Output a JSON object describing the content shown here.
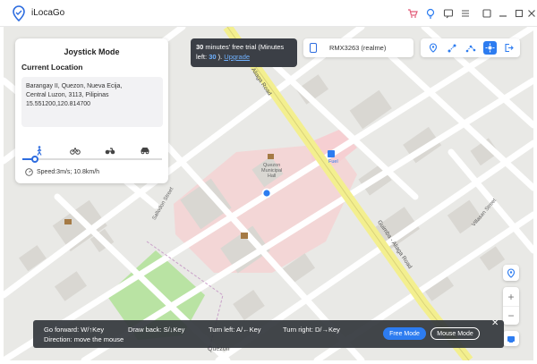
{
  "app": {
    "title": "iLocaGo"
  },
  "titlebar": {
    "icons": [
      "cart-icon",
      "bulb-icon",
      "message-icon",
      "menu-icon",
      "minimize-icon",
      "restore-icon",
      "close-icon"
    ]
  },
  "joystick": {
    "title": "Joystick Mode",
    "current_location_label": "Current Location",
    "address_lines": [
      "Barangay II, Quezon, Nueva Ecija,",
      "Central Luzon, 3113, Pilipinas",
      "15.551200,120.814700"
    ],
    "modes": [
      "walk-icon",
      "bike-icon",
      "motorbike-icon",
      "car-icon"
    ],
    "speed_fraction": 0.09,
    "speed_text": "Speed:3m/s; 10.8km/h"
  },
  "trial": {
    "bold": "30",
    "text1": " minutes' free trial (Minutes",
    "text2": "left: ",
    "left": "30",
    "text3": " ). ",
    "upgrade": "Upgrade"
  },
  "device": {
    "name": "RMX3263 (realme)"
  },
  "map_labels": {
    "road1": "Aliaga Road",
    "road2": "Guimba - Aliaga Road",
    "road3": "Villasan Street",
    "road4": "Sallodon Street",
    "road5": "Quezon",
    "hall1": "Quezon",
    "hall2": "Municipal",
    "hall3": "Hall",
    "fuel": "Fuel"
  },
  "bottom": {
    "forward": "Go forward: W/↑Key",
    "back": "Draw back: S/↓Key",
    "left": "Turn left: A/←Key",
    "right": "Turn right: D/→Key",
    "direction": "Direction: move the mouse",
    "free_mode": "Free Mode",
    "mouse_mode": "Mouse Mode",
    "close": "✕"
  },
  "zoom": {
    "in": "+",
    "out": "−"
  },
  "colors": {
    "accent": "#2d7cf0",
    "road_yellow": "#f3ef8f",
    "zone_pink": "#f3d6d6",
    "park_green": "#b9e3a3"
  }
}
